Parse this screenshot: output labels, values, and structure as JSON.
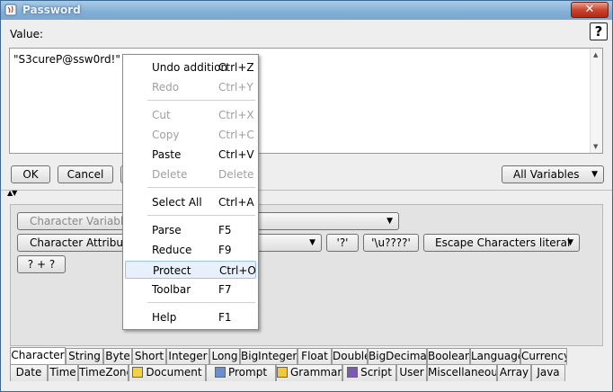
{
  "window": {
    "title": "Password",
    "close_label": "✕"
  },
  "editor": {
    "value_label": "Value:",
    "help_label": "?",
    "text": "\"S3cureP@ssw0rd!\"",
    "ok_label": "OK",
    "cancel_label": "Cancel",
    "variables_combo": "All Variables"
  },
  "lower_panel": {
    "character_variables": "Character Variables",
    "character_attributes": "Character Attributes",
    "char_literal": "'?'",
    "unicode_literal": "'\\u????'",
    "escape_combo": "Escape Characters literal",
    "concat_button": "? + ?"
  },
  "tabs_row1": [
    "Character",
    "String",
    "Byte",
    "Short",
    "Integer",
    "Long",
    "BigInteger",
    "Float",
    "Double",
    "BigDecimal",
    "Boolean",
    "Language",
    "Currency"
  ],
  "selected_tab": "Character",
  "tabs_row2": [
    {
      "label": "Date",
      "icon": ""
    },
    {
      "label": "Time",
      "icon": ""
    },
    {
      "label": "TimeZone",
      "icon": ""
    },
    {
      "label": "Document",
      "icon": "document-icon"
    },
    {
      "label": "Prompt",
      "icon": "prompt-icon"
    },
    {
      "label": "Grammar",
      "icon": "grammar-icon"
    },
    {
      "label": "Script",
      "icon": "script-icon"
    },
    {
      "label": "User",
      "icon": ""
    },
    {
      "label": "Miscellaneous",
      "icon": ""
    },
    {
      "label": "Array",
      "icon": ""
    },
    {
      "label": "Java",
      "icon": ""
    }
  ],
  "context_menu": {
    "items": [
      {
        "label": "Undo addition",
        "shortcut": "Ctrl+Z",
        "enabled": true
      },
      {
        "label": "Redo",
        "shortcut": "Ctrl+Y",
        "enabled": false
      },
      {
        "label": "Cut",
        "shortcut": "Ctrl+X",
        "enabled": false
      },
      {
        "label": "Copy",
        "shortcut": "Ctrl+C",
        "enabled": false
      },
      {
        "label": "Paste",
        "shortcut": "Ctrl+V",
        "enabled": true
      },
      {
        "label": "Delete",
        "shortcut": "Delete",
        "enabled": false
      },
      {
        "label": "Select All",
        "shortcut": "Ctrl+A",
        "enabled": true
      },
      {
        "label": "Parse",
        "shortcut": "F5",
        "enabled": true
      },
      {
        "label": "Reduce",
        "shortcut": "F9",
        "enabled": true
      },
      {
        "label": "Protect",
        "shortcut": "Ctrl+O",
        "enabled": true,
        "highlighted": true
      },
      {
        "label": "Toolbar",
        "shortcut": "F7",
        "enabled": true
      },
      {
        "label": "Help",
        "shortcut": "F1",
        "enabled": true
      }
    ]
  }
}
